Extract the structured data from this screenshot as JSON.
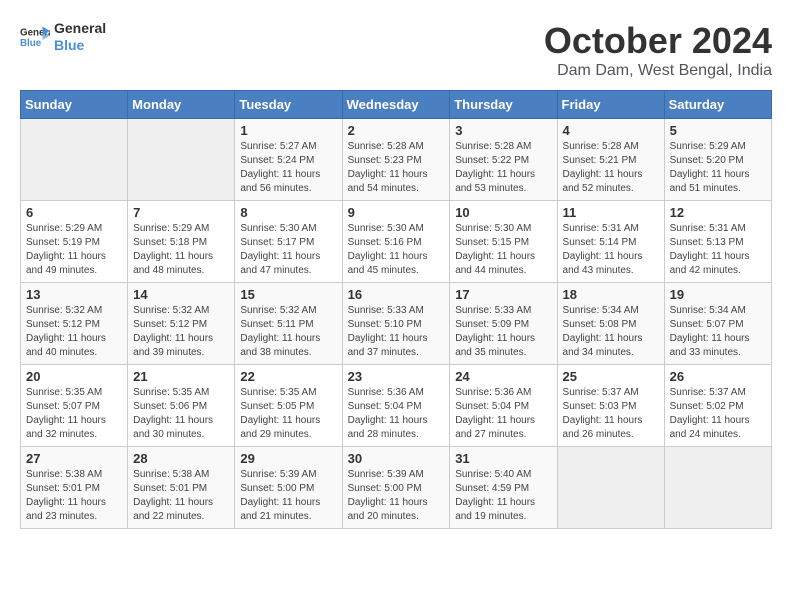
{
  "logo": {
    "line1": "General",
    "line2": "Blue"
  },
  "title": "October 2024",
  "subtitle": "Dam Dam, West Bengal, India",
  "headers": [
    "Sunday",
    "Monday",
    "Tuesday",
    "Wednesday",
    "Thursday",
    "Friday",
    "Saturday"
  ],
  "weeks": [
    [
      {
        "day": "",
        "info": ""
      },
      {
        "day": "",
        "info": ""
      },
      {
        "day": "1",
        "info": "Sunrise: 5:27 AM\nSunset: 5:24 PM\nDaylight: 11 hours and 56 minutes."
      },
      {
        "day": "2",
        "info": "Sunrise: 5:28 AM\nSunset: 5:23 PM\nDaylight: 11 hours and 54 minutes."
      },
      {
        "day": "3",
        "info": "Sunrise: 5:28 AM\nSunset: 5:22 PM\nDaylight: 11 hours and 53 minutes."
      },
      {
        "day": "4",
        "info": "Sunrise: 5:28 AM\nSunset: 5:21 PM\nDaylight: 11 hours and 52 minutes."
      },
      {
        "day": "5",
        "info": "Sunrise: 5:29 AM\nSunset: 5:20 PM\nDaylight: 11 hours and 51 minutes."
      }
    ],
    [
      {
        "day": "6",
        "info": "Sunrise: 5:29 AM\nSunset: 5:19 PM\nDaylight: 11 hours and 49 minutes."
      },
      {
        "day": "7",
        "info": "Sunrise: 5:29 AM\nSunset: 5:18 PM\nDaylight: 11 hours and 48 minutes."
      },
      {
        "day": "8",
        "info": "Sunrise: 5:30 AM\nSunset: 5:17 PM\nDaylight: 11 hours and 47 minutes."
      },
      {
        "day": "9",
        "info": "Sunrise: 5:30 AM\nSunset: 5:16 PM\nDaylight: 11 hours and 45 minutes."
      },
      {
        "day": "10",
        "info": "Sunrise: 5:30 AM\nSunset: 5:15 PM\nDaylight: 11 hours and 44 minutes."
      },
      {
        "day": "11",
        "info": "Sunrise: 5:31 AM\nSunset: 5:14 PM\nDaylight: 11 hours and 43 minutes."
      },
      {
        "day": "12",
        "info": "Sunrise: 5:31 AM\nSunset: 5:13 PM\nDaylight: 11 hours and 42 minutes."
      }
    ],
    [
      {
        "day": "13",
        "info": "Sunrise: 5:32 AM\nSunset: 5:12 PM\nDaylight: 11 hours and 40 minutes."
      },
      {
        "day": "14",
        "info": "Sunrise: 5:32 AM\nSunset: 5:12 PM\nDaylight: 11 hours and 39 minutes."
      },
      {
        "day": "15",
        "info": "Sunrise: 5:32 AM\nSunset: 5:11 PM\nDaylight: 11 hours and 38 minutes."
      },
      {
        "day": "16",
        "info": "Sunrise: 5:33 AM\nSunset: 5:10 PM\nDaylight: 11 hours and 37 minutes."
      },
      {
        "day": "17",
        "info": "Sunrise: 5:33 AM\nSunset: 5:09 PM\nDaylight: 11 hours and 35 minutes."
      },
      {
        "day": "18",
        "info": "Sunrise: 5:34 AM\nSunset: 5:08 PM\nDaylight: 11 hours and 34 minutes."
      },
      {
        "day": "19",
        "info": "Sunrise: 5:34 AM\nSunset: 5:07 PM\nDaylight: 11 hours and 33 minutes."
      }
    ],
    [
      {
        "day": "20",
        "info": "Sunrise: 5:35 AM\nSunset: 5:07 PM\nDaylight: 11 hours and 32 minutes."
      },
      {
        "day": "21",
        "info": "Sunrise: 5:35 AM\nSunset: 5:06 PM\nDaylight: 11 hours and 30 minutes."
      },
      {
        "day": "22",
        "info": "Sunrise: 5:35 AM\nSunset: 5:05 PM\nDaylight: 11 hours and 29 minutes."
      },
      {
        "day": "23",
        "info": "Sunrise: 5:36 AM\nSunset: 5:04 PM\nDaylight: 11 hours and 28 minutes."
      },
      {
        "day": "24",
        "info": "Sunrise: 5:36 AM\nSunset: 5:04 PM\nDaylight: 11 hours and 27 minutes."
      },
      {
        "day": "25",
        "info": "Sunrise: 5:37 AM\nSunset: 5:03 PM\nDaylight: 11 hours and 26 minutes."
      },
      {
        "day": "26",
        "info": "Sunrise: 5:37 AM\nSunset: 5:02 PM\nDaylight: 11 hours and 24 minutes."
      }
    ],
    [
      {
        "day": "27",
        "info": "Sunrise: 5:38 AM\nSunset: 5:01 PM\nDaylight: 11 hours and 23 minutes."
      },
      {
        "day": "28",
        "info": "Sunrise: 5:38 AM\nSunset: 5:01 PM\nDaylight: 11 hours and 22 minutes."
      },
      {
        "day": "29",
        "info": "Sunrise: 5:39 AM\nSunset: 5:00 PM\nDaylight: 11 hours and 21 minutes."
      },
      {
        "day": "30",
        "info": "Sunrise: 5:39 AM\nSunset: 5:00 PM\nDaylight: 11 hours and 20 minutes."
      },
      {
        "day": "31",
        "info": "Sunrise: 5:40 AM\nSunset: 4:59 PM\nDaylight: 11 hours and 19 minutes."
      },
      {
        "day": "",
        "info": ""
      },
      {
        "day": "",
        "info": ""
      }
    ]
  ]
}
